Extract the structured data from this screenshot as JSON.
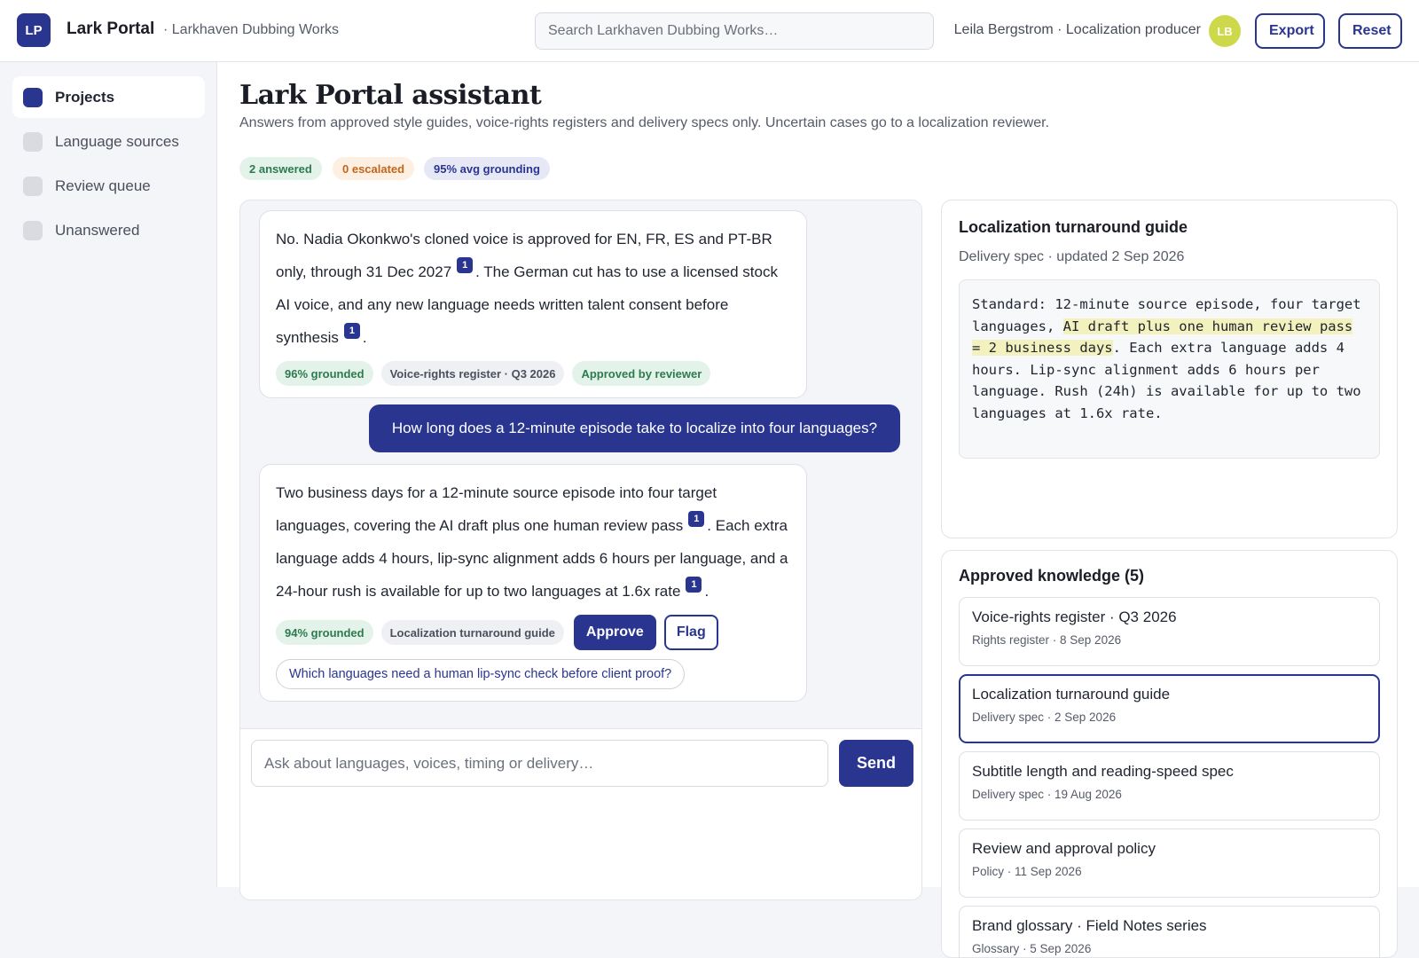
{
  "header": {
    "logo_initials": "LP",
    "app_name": "Lark Portal",
    "org_name": "· Larkhaven Dubbing Works",
    "search_placeholder": "Search Larkhaven Dubbing Works…",
    "user_label": "Leila Bergstrom · Localization producer",
    "user_initials": "LB",
    "export_label": "Export",
    "reset_label": "Reset"
  },
  "sidebar": {
    "items": [
      {
        "label": "Projects",
        "active": true
      },
      {
        "label": "Language sources",
        "active": false
      },
      {
        "label": "Review queue",
        "active": false
      },
      {
        "label": "Unanswered",
        "active": false
      }
    ]
  },
  "main": {
    "title": "Lark Portal assistant",
    "subtitle": "Answers from approved style guides, voice-rights registers and delivery specs only. Uncertain cases go to a localization reviewer.",
    "stats": {
      "answered": "2 answered",
      "escalated": "0 escalated",
      "grounding": "95% avg grounding"
    }
  },
  "chat": {
    "messages": [
      {
        "role": "assistant",
        "text_1": "No. Nadia Okonkwo's cloned voice is approved for EN, FR, ES and PT-BR only, through 31 Dec 2027",
        "cite_1": "1",
        "text_2": ". The German cut has to use a licensed stock AI voice, and any new language needs written talent consent before synthesis",
        "cite_2": "1",
        "text_3": ".",
        "grounded": "96% grounded",
        "source": "Voice-rights register · Q3 2026",
        "status": "Approved by reviewer"
      },
      {
        "role": "user",
        "text": "How long does a 12-minute episode take to localize into four languages?"
      },
      {
        "role": "assistant",
        "text_1": "Two business days for a 12-minute source episode into four target languages, covering the AI draft plus one human review pass",
        "cite_1": "1",
        "text_2": ". Each extra language adds 4 hours, lip-sync alignment adds 6 hours per language, and a 24-hour rush is available for up to two languages at 1.6x rate",
        "cite_2": "1",
        "text_3": ".",
        "grounded": "94% grounded",
        "source": "Localization turnaround guide",
        "approve_label": "Approve",
        "flag_label": "Flag",
        "followup": "Which languages need a human lip-sync check before client proof?"
      }
    ],
    "input_placeholder": "Ask about languages, voices, timing or delivery…",
    "send_label": "Send"
  },
  "document": {
    "title": "Localization turnaround guide",
    "meta": "Delivery spec · updated 2 Sep 2026",
    "body_before": "Standard: 12-minute source episode, four target languages, ",
    "body_highlight": "AI draft plus one human review pass = 2 business days",
    "body_after": ". Each extra language adds 4 hours. Lip-sync alignment adds 6 hours per language. Rush (24h) is available for up to two languages at 1.6x rate."
  },
  "knowledge": {
    "title": "Approved knowledge (5)",
    "items": [
      {
        "name": "Voice-rights register · Q3 2026",
        "meta": "Rights register · 8 Sep 2026"
      },
      {
        "name": "Localization turnaround guide",
        "meta": "Delivery spec · 2 Sep 2026"
      },
      {
        "name": "Subtitle length and reading-speed spec",
        "meta": "Delivery spec · 19 Aug 2026"
      },
      {
        "name": "Review and approval policy",
        "meta": "Policy · 11 Sep 2026"
      },
      {
        "name": "Brand glossary · Field Notes series",
        "meta": "Glossary · 5 Sep 2026"
      }
    ]
  },
  "colors": {
    "accent": "#2a3590",
    "success": "#2e7a4f",
    "warning": "#c2651c",
    "highlight": "#f3f1bd"
  }
}
